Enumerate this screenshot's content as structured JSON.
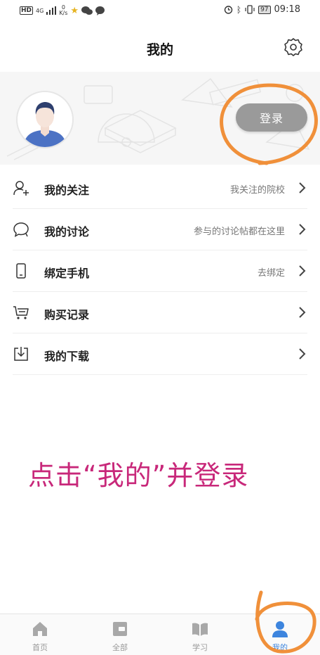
{
  "status_bar": {
    "network_label": "HD",
    "network_type": "4G",
    "speed_value": "0",
    "speed_unit": "K/s",
    "battery": "97",
    "time": "09:18"
  },
  "header": {
    "title": "我的"
  },
  "profile": {
    "login_label": "登录"
  },
  "menu": [
    {
      "label": "我的关注",
      "hint": "我关注的院校",
      "icon": "follow-user-icon"
    },
    {
      "label": "我的讨论",
      "hint": "参与的讨论帖都在这里",
      "icon": "chat-bubble-icon"
    },
    {
      "label": "绑定手机",
      "hint": "去绑定",
      "icon": "phone-icon"
    },
    {
      "label": "购买记录",
      "hint": "",
      "icon": "cart-icon"
    },
    {
      "label": "我的下载",
      "hint": "",
      "icon": "download-icon"
    }
  ],
  "annotation": {
    "instruction": "点击“我的”并登录",
    "color": "#c8287a",
    "circle_color": "#f0903a"
  },
  "tabs": [
    {
      "label": "首页",
      "icon": "home-icon",
      "active": false
    },
    {
      "label": "全部",
      "icon": "wallet-icon",
      "active": false
    },
    {
      "label": "学习",
      "icon": "book-icon",
      "active": false
    },
    {
      "label": "我的",
      "icon": "person-icon",
      "active": true
    }
  ],
  "colors": {
    "accent": "#3d85de",
    "inactive_tab": "#999999",
    "login_button": "#9a9a9a"
  }
}
